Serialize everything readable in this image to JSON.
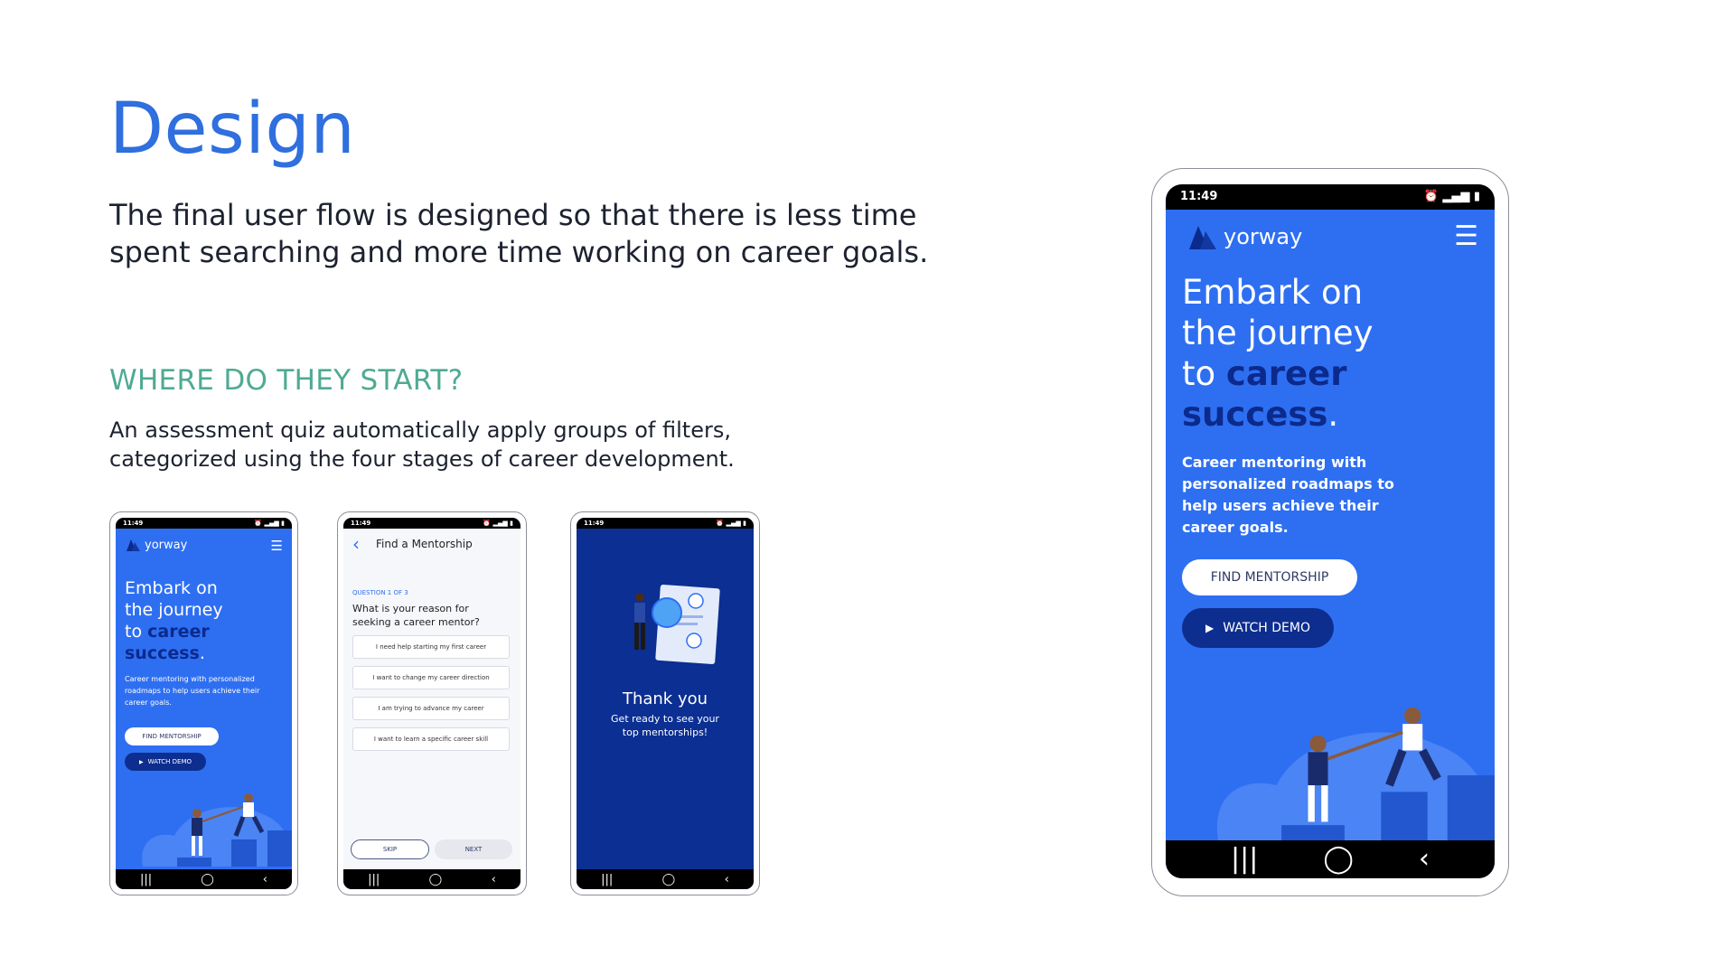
{
  "title": "Design",
  "intro": "The final user flow is designed so that there is less time spent searching and more time working on career goals.",
  "section": {
    "heading": "WHERE DO THEY START?",
    "text": "An assessment quiz automatically apply groups of filters, categorized using the four stages of career development."
  },
  "phone_common": {
    "time": "11:49",
    "status_icons": "⏰ ▂▄▆ ▮",
    "brand": "yorway",
    "nav_recent": "|||",
    "nav_home": "◯",
    "nav_back": "‹"
  },
  "landing": {
    "headline_1": "Embark on",
    "headline_2": "the journey",
    "headline_3_prefix": "to ",
    "headline_3_accent": "career",
    "headline_4_accent": "success",
    "headline_4_suffix": ".",
    "description": "Career mentoring with personalized roadmaps to help users achieve their career goals.",
    "find_button": "FIND MENTORSHIP",
    "demo_button": "WATCH DEMO",
    "play_icon": "▶"
  },
  "quiz": {
    "back_icon": "‹",
    "header_title": "Find a Mentorship",
    "question_counter": "QUESTION 1 OF 3",
    "question": "What is your reason for seeking a career mentor?",
    "options": [
      "I need help starting my first career",
      "I want to change my career direction",
      "I am trying to advance my career",
      "I want to learn a specific career skill"
    ],
    "skip_button": "SKIP",
    "next_button": "NEXT"
  },
  "thanks": {
    "title": "Thank you",
    "message": "Get ready to see your top mentorships!"
  },
  "colors": {
    "brand_blue": "#2e6ff2",
    "navy": "#0b2f92",
    "title_blue": "#2f6fde",
    "teal": "#4faa93"
  }
}
